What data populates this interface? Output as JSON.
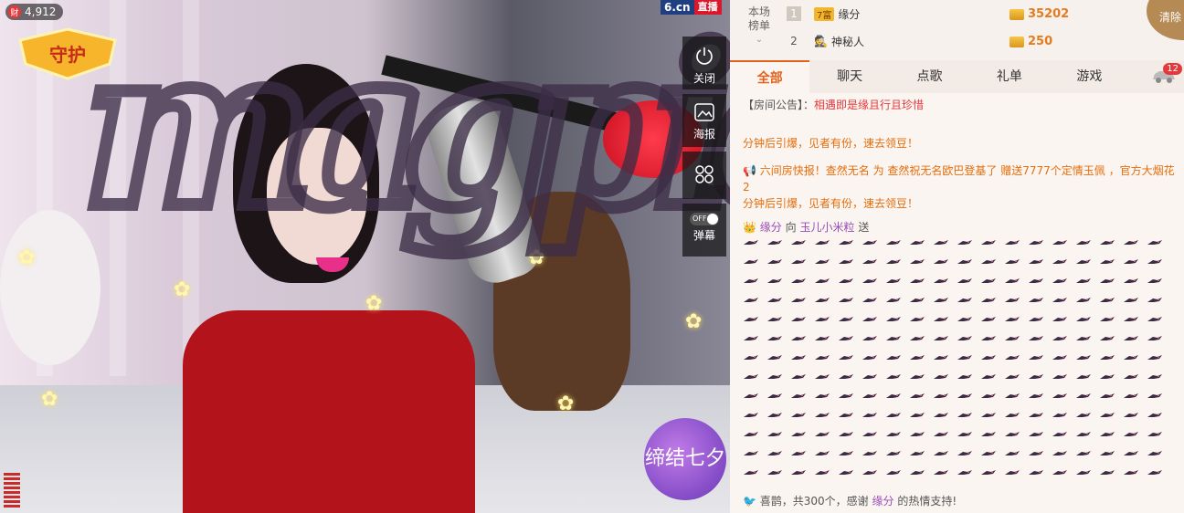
{
  "video": {
    "wealth_value": "4,912",
    "wealth_icon": "财",
    "guard_label": "守护",
    "overlay_text": "magpie",
    "qixi_badge": "缔结七夕",
    "logo": {
      "site": "6.cn",
      "live": "直播"
    },
    "controls": [
      {
        "icon": "power-icon",
        "label": "关闭"
      },
      {
        "icon": "poster-icon",
        "label": "海报"
      },
      {
        "icon": "apps-icon",
        "label": ""
      },
      {
        "icon": "toggle-icon",
        "label": "弹幕",
        "toggle_text": "OFF",
        "toggle_state": "off"
      }
    ]
  },
  "ranking": {
    "title_line1": "本场",
    "title_line2": "榜单",
    "rows": [
      {
        "rank": "1",
        "level": "7富",
        "user": "缘分",
        "coins": "35202"
      },
      {
        "rank": "2",
        "level": "",
        "user": "神秘人",
        "coins": "250"
      }
    ],
    "clear_label": "清除"
  },
  "tabs": [
    {
      "label": "全部",
      "active": true
    },
    {
      "label": "聊天",
      "active": false
    },
    {
      "label": "点歌",
      "active": false
    },
    {
      "label": "礼单",
      "active": false
    },
    {
      "label": "游戏",
      "active": false
    }
  ],
  "car_badge": "12",
  "chat": {
    "notice_prefix": "【房间公告】：",
    "notice_text": "相遇即是缘且行且珍惜",
    "line_promo": "分钟后引爆，见者有份，速去领豆！",
    "flash_line1": "六间房快报！查然无名 为 查然祝无名欧巴登基了 赠送7777个定情玉佩 ，官方大烟花2",
    "flash_line2": "分钟后引爆，见者有份，速去领豆！",
    "gift_user": "缘分",
    "gift_verb": "向",
    "gift_target": "玉儿小米粒",
    "gift_action": "送",
    "footer_prefix": "喜鹊，共300个，感谢",
    "footer_user": "缘分",
    "footer_suffix": "的热情支持!"
  }
}
